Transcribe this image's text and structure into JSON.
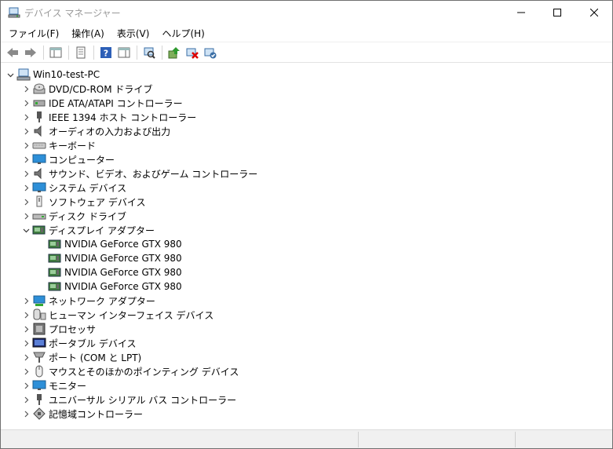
{
  "window": {
    "title": "デバイス マネージャー"
  },
  "menu": [
    {
      "label": "ファイル(F)"
    },
    {
      "label": "操作(A)"
    },
    {
      "label": "表示(V)"
    },
    {
      "label": "ヘルプ(H)"
    }
  ],
  "tree": {
    "root": {
      "label": "Win10-test-PC",
      "icon": "computer-icon"
    },
    "categories": [
      {
        "label": "DVD/CD-ROM ドライブ",
        "icon": "dvd-drive-icon"
      },
      {
        "label": "IDE ATA/ATAPI コントローラー",
        "icon": "ide-controller-icon"
      },
      {
        "label": "IEEE 1394 ホスト コントローラー",
        "icon": "ieee1394-icon"
      },
      {
        "label": "オーディオの入力および出力",
        "icon": "speaker-icon"
      },
      {
        "label": "キーボード",
        "icon": "keyboard-icon"
      },
      {
        "label": "コンピューター",
        "icon": "monitor-icon"
      },
      {
        "label": "サウンド、ビデオ、およびゲーム コントローラー",
        "icon": "speaker-icon"
      },
      {
        "label": "システム デバイス",
        "icon": "monitor-icon"
      },
      {
        "label": "ソフトウェア デバイス",
        "icon": "software-device-icon"
      },
      {
        "label": "ディスク ドライブ",
        "icon": "disk-drive-icon"
      },
      {
        "label": "ディスプレイ アダプター",
        "icon": "display-adapter-icon",
        "expanded": true,
        "children": [
          {
            "label": "NVIDIA GeForce GTX 980",
            "icon": "display-adapter-icon"
          },
          {
            "label": "NVIDIA GeForce GTX 980",
            "icon": "display-adapter-icon"
          },
          {
            "label": "NVIDIA GeForce GTX 980",
            "icon": "display-adapter-icon"
          },
          {
            "label": "NVIDIA GeForce GTX 980",
            "icon": "display-adapter-icon"
          }
        ]
      },
      {
        "label": "ネットワーク アダプター",
        "icon": "network-icon"
      },
      {
        "label": "ヒューマン インターフェイス デバイス",
        "icon": "hid-icon"
      },
      {
        "label": "プロセッサ",
        "icon": "processor-icon"
      },
      {
        "label": "ポータブル デバイス",
        "icon": "portable-device-icon"
      },
      {
        "label": "ポート (COM と LPT)",
        "icon": "port-icon"
      },
      {
        "label": "マウスとそのほかのポインティング デバイス",
        "icon": "mouse-icon"
      },
      {
        "label": "モニター",
        "icon": "monitor-icon"
      },
      {
        "label": "ユニバーサル シリアル バス コントローラー",
        "icon": "usb-icon"
      },
      {
        "label": "記憶域コントローラー",
        "icon": "storage-controller-icon"
      }
    ]
  },
  "colors": {
    "title_text": "#999999",
    "statusbar_bg": "#f0f0f0",
    "window_border": "#6f6f6f"
  }
}
